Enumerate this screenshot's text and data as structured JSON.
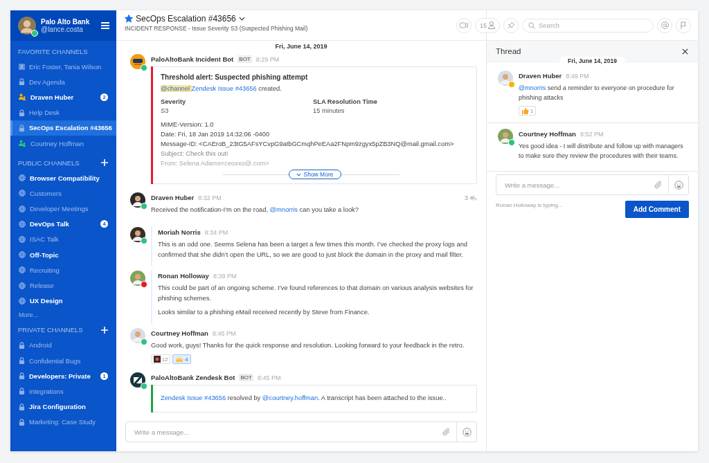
{
  "user": {
    "name": "Palo Alto Bank",
    "handle": "@lance.costa",
    "status": {
      "color": "#2ec27e"
    }
  },
  "sidebar": {
    "sections": [
      {
        "title": "FAVORITE CHANNELS",
        "addable": false,
        "items": [
          {
            "label": "Eric Foster, Tania Wilson",
            "kind": "count",
            "count": "2",
            "unread": false,
            "selected": false
          },
          {
            "label": "Dev Agenda",
            "kind": "lock",
            "unread": false,
            "selected": false
          },
          {
            "label": "Draven Huber",
            "kind": "person",
            "color": "#f5b400",
            "unread": true,
            "badge": "2",
            "selected": false
          },
          {
            "label": "Help Desk",
            "kind": "lock",
            "unread": false,
            "selected": false
          },
          {
            "label": "SecOps Escalation #43656",
            "kind": "lock",
            "unread": true,
            "selected": true
          },
          {
            "label": "Courtney Hoffman",
            "kind": "person",
            "color": "#2ec27e",
            "unread": false,
            "selected": false
          }
        ]
      },
      {
        "title": "PUBLIC CHANNELS",
        "addable": true,
        "items": [
          {
            "label": "Browser Compatibility",
            "kind": "globe",
            "unread": true,
            "selected": false
          },
          {
            "label": "Customers",
            "kind": "globe",
            "unread": false,
            "selected": false
          },
          {
            "label": "Developer Meetings",
            "kind": "globe",
            "unread": false,
            "selected": false
          },
          {
            "label": "DevOps Talk",
            "kind": "globe",
            "unread": true,
            "badge": "4",
            "selected": false
          },
          {
            "label": "ISAC Talk",
            "kind": "globe",
            "unread": false,
            "selected": false
          },
          {
            "label": "Off-Topic",
            "kind": "globe",
            "unread": true,
            "selected": false
          },
          {
            "label": "Recruiting",
            "kind": "globe",
            "unread": false,
            "selected": false
          },
          {
            "label": "Release",
            "kind": "globe",
            "unread": false,
            "selected": false
          },
          {
            "label": "UX Design",
            "kind": "globe",
            "unread": true,
            "selected": false
          }
        ],
        "more": "More..."
      },
      {
        "title": "PRIVATE CHANNELS",
        "addable": true,
        "items": [
          {
            "label": "Android",
            "kind": "lock",
            "unread": false,
            "selected": false
          },
          {
            "label": "Confidential Bugs",
            "kind": "lock",
            "unread": false,
            "selected": false
          },
          {
            "label": "Developers: Private",
            "kind": "lock",
            "unread": true,
            "badge": "1",
            "selected": false
          },
          {
            "label": "Integrations",
            "kind": "lock",
            "unread": false,
            "selected": false
          },
          {
            "label": "Jira Configuration",
            "kind": "lock",
            "unread": true,
            "selected": false
          },
          {
            "label": "Marketing: Case Study",
            "kind": "lock",
            "unread": false,
            "selected": false
          }
        ]
      }
    ]
  },
  "channel": {
    "starred": true,
    "title": "SecOps Escalation #43656",
    "subtitle": "INCIDENT RESPONSE - Issue Severity S3 (Suspected Phishing Mail)",
    "members": "15",
    "search": {
      "placeholder": "Search"
    }
  },
  "date": "Fri, June 14, 2019",
  "messages": [
    {
      "kind": "bot_card",
      "avatar": {
        "kind": "bot"
      },
      "status": {
        "color": "#2ec27e"
      },
      "author": "PaloAltoBank Incident Bot",
      "tag": "BOT",
      "time": "8:29 PM",
      "card": {
        "color": "#e8192c",
        "title": "Threshold alert: Suspected phishing attempt",
        "parts": [
          {
            "kind": "highlight",
            "text": "@channel "
          },
          {
            "kind": "link",
            "text": "Zendesk Issue #43656"
          },
          {
            "kind": "text",
            "text": " created."
          }
        ],
        "fields": [
          {
            "label": "Severity",
            "value": "S3"
          },
          {
            "label": "SLA Resolution Time",
            "value": "15 minutes"
          }
        ],
        "lines": [
          "MIME-Version: 1.0",
          "Date: Fri, 18 Jan 2019 14:32:06 -0400",
          "Message-ID: <CAEroB_23tG5AFsYCvpG9atbGCmqhPeEAa2FNpm9zgyx5pZB3NQ@mail.gmail.com>",
          "Subject: Check this out!",
          "From: Selena Adams<ceoxxo@.com>"
        ],
        "show_more": "Show More"
      }
    },
    {
      "kind": "message",
      "avatar": {
        "kind": "person"
      },
      "status": {
        "color": "#2ec27e"
      },
      "author": "Draven Huber",
      "time": "8:32 PM",
      "replies": "3",
      "paragraphs": [
        [
          {
            "kind": "text",
            "text": "Received the notification-I’m on the road, "
          },
          {
            "kind": "link",
            "text": "@mnorris"
          },
          {
            "kind": "text",
            "text": " can you take a look?"
          }
        ]
      ]
    },
    {
      "kind": "reply",
      "avatar": {
        "kind": "person"
      },
      "status": {
        "color": "#2ec27e"
      },
      "author": "Moriah Norris",
      "time": "8:34 PM",
      "paragraphs": [
        [
          {
            "kind": "text",
            "text": "This is an odd one. Seems Selena has been a target a few times this month. I’ve checked the proxy logs and confirmed that she didn’t open the URL, so we are good to just block the domain in the proxy and mail filter."
          }
        ]
      ]
    },
    {
      "kind": "reply",
      "avatar": {
        "kind": "person"
      },
      "status": {
        "color": "#e8192c"
      },
      "author": "Ronan Holloway",
      "time": "8:39 PM",
      "paragraphs": [
        [
          {
            "kind": "text",
            "text": "This could be part of an ongoing scheme. I’ve found references to that domain on various analysis websites for phishing schemes."
          }
        ],
        [
          {
            "kind": "text",
            "text": "Looks similar to a phishing eMail received recently by Steve from Finance."
          }
        ]
      ]
    },
    {
      "kind": "message",
      "avatar": {
        "kind": "person"
      },
      "status": {
        "color": "#2ec27e"
      },
      "author": "Courtney Hoffman",
      "time": "8:45 PM",
      "paragraphs": [
        [
          {
            "kind": "text",
            "text": "Good work, guys! Thanks for the quick response and resolution. Looking forward to your feedback in the retro."
          }
        ]
      ],
      "reactions": [
        {
          "kind": "image",
          "count": "12",
          "selected": false
        },
        {
          "kind": "hands",
          "count": "4",
          "selected": true
        }
      ]
    },
    {
      "kind": "bot_card",
      "avatar": {
        "kind": "zendesk"
      },
      "status": {
        "color": "#2ec27e"
      },
      "author": "PaloAltoBank Zendesk Bot",
      "tag": "BOT",
      "time": "8:45 PM",
      "card": {
        "color": "#1aa34a",
        "parts": [
          {
            "kind": "link",
            "text": "Zendesk Issue #43656"
          },
          {
            "kind": "text",
            "text": " resolved by "
          },
          {
            "kind": "link",
            "text": "@courtney.hoffman"
          },
          {
            "kind": "text",
            "text": ".  A transcript has been attached to the issue.."
          }
        ]
      }
    }
  ],
  "composer": {
    "placeholder": "Write a message..."
  },
  "thread": {
    "title": "Thread",
    "date": "Fri, June 14, 2019",
    "messages": [
      {
        "status": {
          "color": "#f5b400"
        },
        "author": "Draven Huber",
        "time": "8:49 PM",
        "parts": [
          {
            "kind": "link",
            "text": "@mnorris"
          },
          {
            "kind": "text",
            "text": " send a reminder to everyone on procedure for phishing attacks"
          }
        ],
        "reactions": [
          {
            "kind": "thumb",
            "count": "1",
            "selected": false
          }
        ]
      },
      {
        "status": {
          "color": "#2ec27e"
        },
        "author": "Courtney Hoffman",
        "time": "8:52 PM",
        "parts": [
          {
            "kind": "text",
            "text": "Yes good idea - I will distribute and follow up with managers to make sure they review the procedures with their teams."
          }
        ]
      }
    ],
    "composer": {
      "placeholder": "Write a message..."
    },
    "typing": "Ronan Holloway is typing...",
    "button": "Add Comment"
  }
}
